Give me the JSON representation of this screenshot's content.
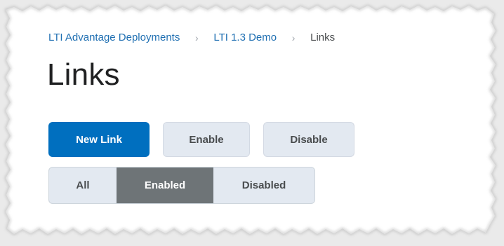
{
  "breadcrumb": {
    "items": [
      "LTI Advantage Deployments",
      "LTI 1.3 Demo"
    ],
    "current": "Links",
    "separator": "›"
  },
  "page": {
    "title": "Links"
  },
  "actions": {
    "new_link": "New Link",
    "enable": "Enable",
    "disable": "Disable"
  },
  "filter": {
    "options": [
      "All",
      "Enabled",
      "Disabled"
    ],
    "selected": "Enabled"
  },
  "colors": {
    "link": "#1f6fb2",
    "primary": "#006fbf",
    "secondary_bg": "#e3e9f1",
    "selected_segment": "#6e7477",
    "text": "#494c4e",
    "title": "#202122"
  }
}
